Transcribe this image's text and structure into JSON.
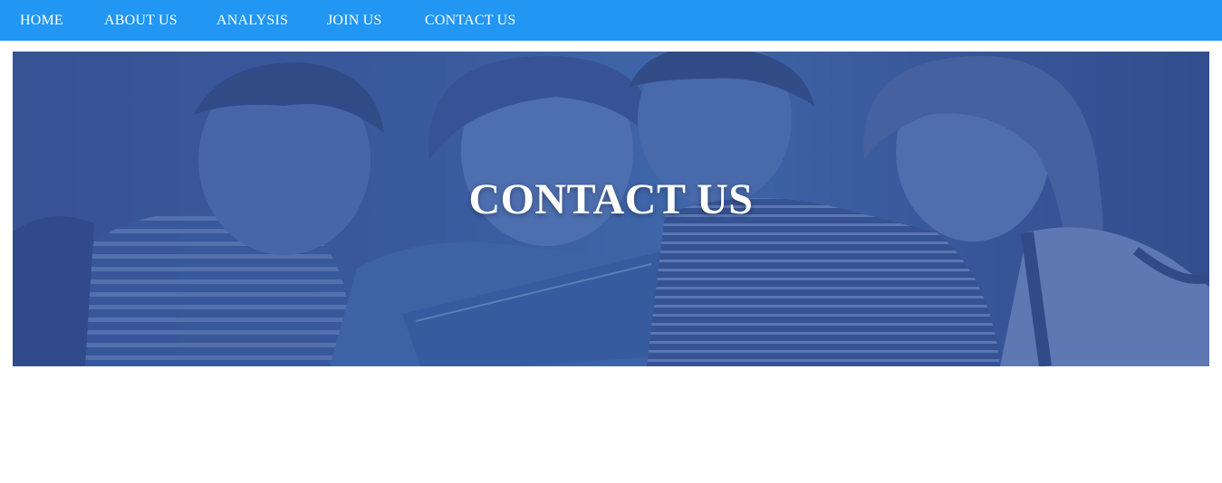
{
  "nav": {
    "items": [
      {
        "label": "HOME"
      },
      {
        "label": "ABOUT US"
      },
      {
        "label": "ANALYSIS"
      },
      {
        "label": "JOIN US"
      },
      {
        "label": "CONTACT US"
      }
    ]
  },
  "hero": {
    "title": "CONTACT US",
    "image": "students-group-photo"
  },
  "colors": {
    "nav_background": "#2196f3",
    "hero_tint": "#3a5595",
    "text": "#ffffff"
  }
}
